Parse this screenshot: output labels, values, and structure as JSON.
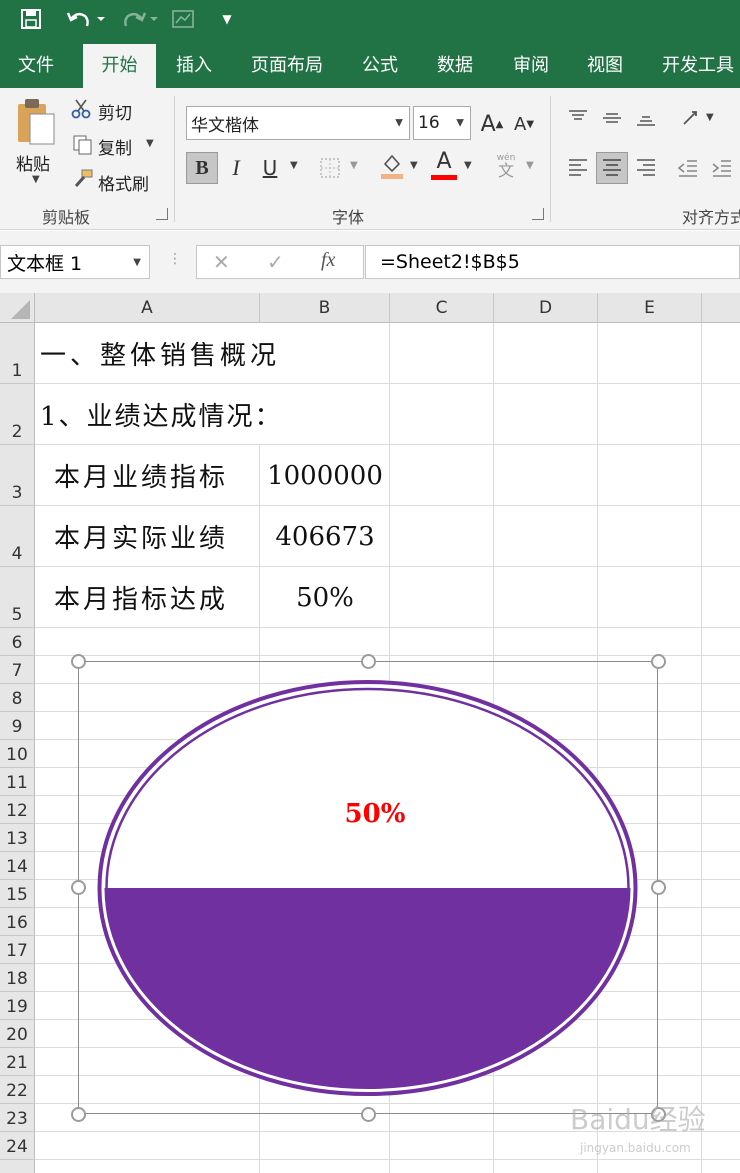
{
  "qat": {
    "undo_icon": "undo-icon",
    "redo_icon": "redo-icon",
    "save_icon": "save-icon"
  },
  "tabs": [
    "文件",
    "开始",
    "插入",
    "页面布局",
    "公式",
    "数据",
    "审阅",
    "视图",
    "开发工具"
  ],
  "ribbon": {
    "clipboard": {
      "paste_label": "粘贴",
      "cut_label": "剪切",
      "copy_label": "复制",
      "format_painter_label": "格式刷",
      "group_label": "剪贴板"
    },
    "font": {
      "font_name": "华文楷体",
      "font_size": "16",
      "bold": "B",
      "italic": "I",
      "underline": "U",
      "font_color_letter": "A",
      "phonetic_top": "wén",
      "phonetic_bottom": "文",
      "group_label": "字体",
      "font_color": "#ff0000",
      "fill_color": "#f4b183"
    },
    "alignment": {
      "group_label": "对齐方式"
    }
  },
  "formula_bar": {
    "name_box": "文本框 1",
    "formula": "=Sheet2!$B$5",
    "fx_label": "fx"
  },
  "sheet": {
    "columns": [
      "A",
      "B",
      "C",
      "D",
      "E"
    ],
    "rows": [
      "1",
      "2",
      "3",
      "4",
      "5",
      "6",
      "7",
      "8",
      "9",
      "10",
      "11",
      "12",
      "13",
      "14",
      "15",
      "16",
      "17",
      "18",
      "19",
      "20",
      "21",
      "22",
      "23",
      "24"
    ],
    "cells": {
      "A1": "一、整体销售概况",
      "A2": "1、业绩达成情况：",
      "A3": "本月业绩指标",
      "B3": "1000000",
      "A4": "本月实际业绩",
      "B4": "406673",
      "A5": "本月指标达成",
      "B5": "50%"
    }
  },
  "chart": {
    "label": "50%",
    "fill_fraction": 0.5,
    "fill_color": "#7030a0",
    "label_color": "#ff0000"
  },
  "watermark": {
    "text": "Baidu经验",
    "sub": "jingyan.baidu.com"
  }
}
